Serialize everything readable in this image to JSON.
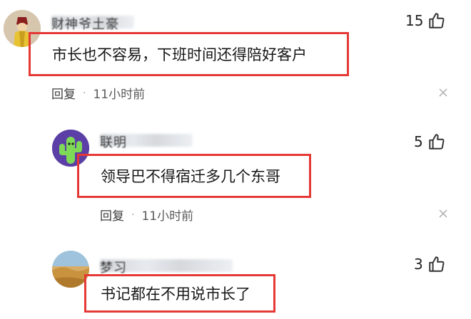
{
  "comments": [
    {
      "username": "财神爷土豪",
      "text": "市长也不容易，下班时间还得陪好客户",
      "reply_label": "回复",
      "separator": "·",
      "time": "11小时前",
      "likes": "15"
    },
    {
      "username": "联明",
      "text": "领导巴不得宿迁多几个东哥",
      "reply_label": "回复",
      "separator": "·",
      "time": "11小时前",
      "likes": "5"
    },
    {
      "username": "梦习",
      "text": "书记都在不用说市长了",
      "likes": "3"
    }
  ],
  "colors": {
    "highlight_border": "#e53935",
    "avatar2_bg": "#5b3fa6",
    "avatar2_cactus": "#7ed957"
  }
}
